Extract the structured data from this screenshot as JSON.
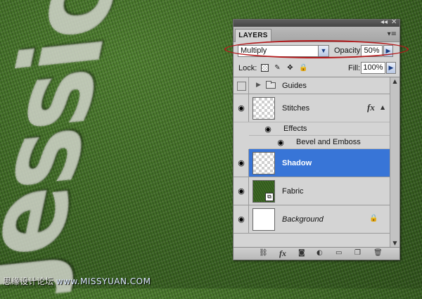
{
  "background": {
    "fabric_color": "#3f6c26",
    "stitch_color": "#b9bcb4",
    "stitch_text": "Jessica"
  },
  "watermark": {
    "text": "思缘设计论坛",
    "url": "www.MISSYUAN.COM"
  },
  "panel": {
    "title": "LAYERS",
    "window_controls": {
      "collapse": "◂◂",
      "close": "✕"
    },
    "menu_icon": "▾≡",
    "blend_mode": "Multiply",
    "opacity_label": "Opacity:",
    "opacity_value": "50%",
    "lock_label": "Lock:",
    "fill_label": "Fill:",
    "fill_value": "100%",
    "selection_color": "#3875d7",
    "annotation_color": "#b3191b"
  },
  "layers": [
    {
      "name": "Guides",
      "type": "group",
      "visible": false
    },
    {
      "name": "Stitches",
      "type": "layer",
      "visible": true,
      "has_fx": true,
      "fx_label": "fx",
      "effects_label": "Effects",
      "effects": [
        "Bevel and Emboss"
      ]
    },
    {
      "name": "Shadow",
      "type": "layer",
      "visible": true,
      "selected": true
    },
    {
      "name": "Fabric",
      "type": "smart-object",
      "visible": true
    },
    {
      "name": "Background",
      "type": "background",
      "visible": true,
      "locked": true
    }
  ],
  "toolbar": {
    "icons": [
      "link-icon",
      "fx-icon",
      "mask-icon",
      "adjustment-icon",
      "folder-icon",
      "new-layer-icon",
      "trash-icon"
    ],
    "fx_label": "fx"
  }
}
